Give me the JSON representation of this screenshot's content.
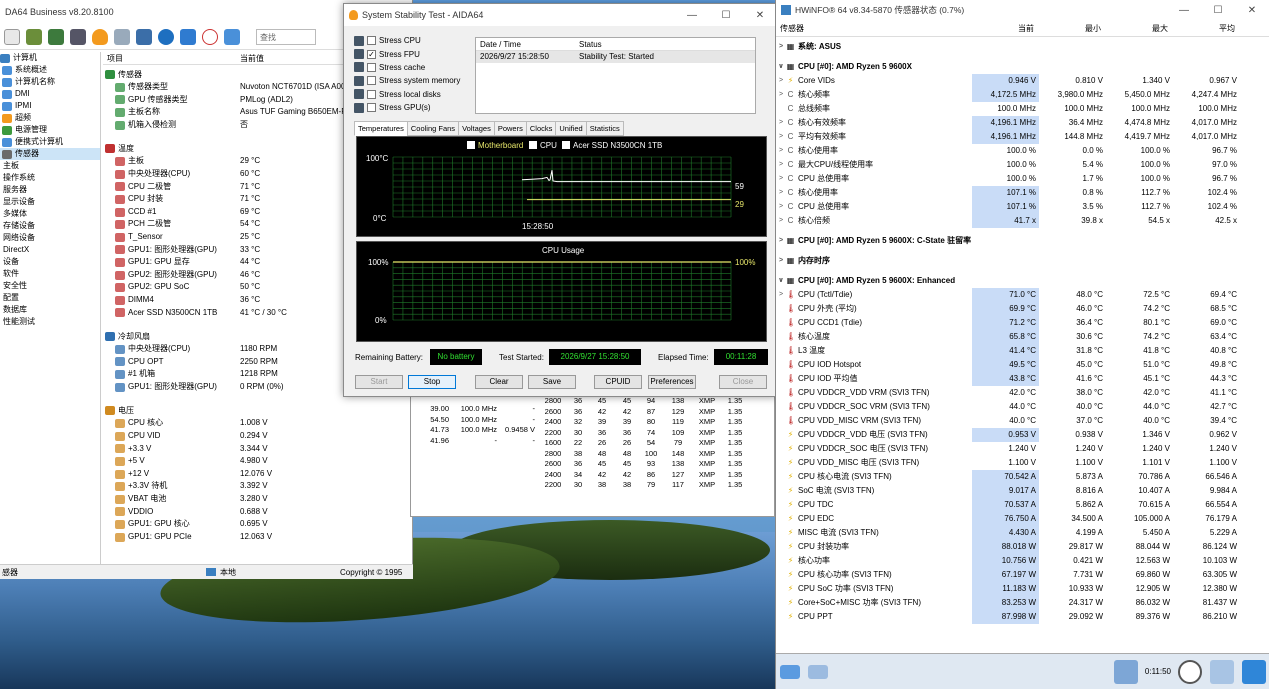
{
  "aida": {
    "title": "DA64 Business v8.20.8100",
    "search_placeholder": "查找",
    "tree": [
      "计算机",
      "系统概述",
      "计算机名称",
      "DMI",
      "IPMI",
      "超频",
      "电源管理",
      "便携式计算机",
      "传感器",
      "主板",
      "操作系统",
      "服务器",
      "显示设备",
      "多媒体",
      "存储设备",
      "网络设备",
      "DirectX",
      "设备",
      "软件",
      "安全性",
      "配置",
      "数据库",
      "性能测试"
    ],
    "col_item": "项目",
    "col_value": "当前值",
    "sections": [
      {
        "title": "传感器",
        "rows": [
          [
            "传感器类型",
            "Nuvoton NCT6701D  (ISA A00"
          ],
          [
            "GPU 传感器类型",
            "PMLog  (ADL2)"
          ],
          [
            "主板名称",
            "Asus TUF Gaming B650EM-PL"
          ],
          [
            "机箱入侵检测",
            "否"
          ]
        ]
      },
      {
        "title": "温度",
        "rows": [
          [
            "主板",
            "29 °C"
          ],
          [
            "中央处理器(CPU)",
            "60 °C"
          ],
          [
            "CPU 二极管",
            "71 °C"
          ],
          [
            "CPU 封装",
            "71 °C"
          ],
          [
            "CCD #1",
            "69 °C"
          ],
          [
            "PCH 二极管",
            "54 °C"
          ],
          [
            "T_Sensor",
            "25 °C"
          ],
          [
            "GPU1: 图形处理器(GPU)",
            "33 °C"
          ],
          [
            "GPU1: GPU 显存",
            "44 °C"
          ],
          [
            "GPU2: 图形处理器(GPU)",
            "46 °C"
          ],
          [
            "GPU2: GPU SoC",
            "50 °C"
          ],
          [
            "DIMM4",
            "36 °C"
          ],
          [
            "Acer SSD N3500CN 1TB",
            "41 °C / 30 °C"
          ]
        ]
      },
      {
        "title": "冷却风扇",
        "rows": [
          [
            "中央处理器(CPU)",
            "1180 RPM"
          ],
          [
            "CPU OPT",
            "2250 RPM"
          ],
          [
            "#1 机箱",
            "1218 RPM"
          ],
          [
            "GPU1: 图形处理器(GPU)",
            "0 RPM  (0%)"
          ]
        ]
      },
      {
        "title": "电压",
        "rows": [
          [
            "CPU 核心",
            "1.008 V"
          ],
          [
            "CPU VID",
            "0.294 V"
          ],
          [
            "+3.3 V",
            "3.344 V"
          ],
          [
            "+5 V",
            "4.980 V"
          ],
          [
            "+12 V",
            "12.076 V"
          ],
          [
            "+3.3V 待机",
            "3.392 V"
          ],
          [
            "VBAT 电池",
            "3.280 V"
          ],
          [
            "VDDIO",
            "0.688 V"
          ],
          [
            "GPU1: GPU 核心",
            "0.695 V"
          ],
          [
            "GPU1: GPU PCIe",
            "12.063 V"
          ]
        ]
      }
    ],
    "status_left": "感器",
    "status_mid": "本地",
    "status_right": "Copyright © 1995"
  },
  "bgwin": {
    "left": [
      [
        "39.00",
        "100.0 MHz",
        "-"
      ],
      [
        "54.50",
        "100.0 MHz",
        "-"
      ],
      [
        "41.73",
        "100.0 MHz",
        "0.9458 V"
      ],
      [
        "41.96",
        "-",
        "-"
      ]
    ],
    "right": [
      [
        "2800",
        "36",
        "45",
        "45",
        "94",
        "138",
        "XMP",
        "1.35"
      ],
      [
        "2600",
        "36",
        "42",
        "42",
        "87",
        "129",
        "XMP",
        "1.35"
      ],
      [
        "2400",
        "32",
        "39",
        "39",
        "80",
        "119",
        "XMP",
        "1.35"
      ],
      [
        "2200",
        "30",
        "36",
        "36",
        "74",
        "109",
        "XMP",
        "1.35"
      ],
      [
        "1600",
        "22",
        "26",
        "26",
        "54",
        "79",
        "XMP",
        "1.35"
      ],
      [
        "2800",
        "38",
        "48",
        "48",
        "100",
        "148",
        "XMP",
        "1.35"
      ],
      [
        "2600",
        "36",
        "45",
        "45",
        "93",
        "138",
        "XMP",
        "1.35"
      ],
      [
        "2400",
        "34",
        "42",
        "42",
        "86",
        "127",
        "XMP",
        "1.35"
      ],
      [
        "2200",
        "30",
        "38",
        "38",
        "79",
        "117",
        "XMP",
        "1.35"
      ]
    ]
  },
  "sst": {
    "title": "System Stability Test - AIDA64",
    "stress": [
      {
        "label": "Stress CPU",
        "checked": false
      },
      {
        "label": "Stress FPU",
        "checked": true
      },
      {
        "label": "Stress cache",
        "checked": false
      },
      {
        "label": "Stress system memory",
        "checked": false
      },
      {
        "label": "Stress local disks",
        "checked": false
      },
      {
        "label": "Stress GPU(s)",
        "checked": false
      }
    ],
    "col_date": "Date / Time",
    "col_status": "Status",
    "log_date": "2026/9/27 15:28:50",
    "log_status": "Stability Test: Started",
    "tabs": [
      "Temperatures",
      "Cooling Fans",
      "Voltages",
      "Powers",
      "Clocks",
      "Unified",
      "Statistics"
    ],
    "legend": [
      "Motherboard",
      "CPU",
      "Acer SSD N3500CN 1TB"
    ],
    "temp_top": "100°C",
    "temp_bottom": "0°C",
    "temp_time": "15:28:50",
    "val1": "59",
    "val2": "29",
    "cpu_title": "CPU Usage",
    "cpu_top": "100%",
    "cpu_bottom": "0%",
    "cpu_right": "100%",
    "battery_label": "Remaining Battery:",
    "battery": "No battery",
    "started_label": "Test Started:",
    "started": "2026/9/27 15:28:50",
    "elapsed_label": "Elapsed Time:",
    "elapsed": "00:11:28",
    "buttons": [
      "Start",
      "Stop",
      "Clear",
      "Save",
      "CPUID",
      "Preferences",
      "Close"
    ],
    "colors": {
      "motherboard": "#ffffff",
      "cpu": "#e6e66a",
      "grid": "#1f7a2a"
    }
  },
  "hw": {
    "title": "HWiNFO® 64 v8.34-5870 传感器状态 (0.7%)",
    "cols": [
      "传感器",
      "当前",
      "最小",
      "最大",
      "平均"
    ],
    "groups": [
      {
        "title": "系统: ASUS",
        "rows": []
      },
      {
        "title": "CPU [#0]: AMD Ryzen 5 9600X",
        "rows": [
          [
            "Core VIDs",
            "0.946 V",
            "0.810 V",
            "1.340 V",
            "0.967 V",
            "⚡",
            1
          ],
          [
            "核心频率",
            "4,172.5 MHz",
            "3,980.0 MHz",
            "5,450.0 MHz",
            "4,247.4 MHz",
            "C",
            1
          ],
          [
            "总线频率",
            "100.0 MHz",
            "100.0 MHz",
            "100.0 MHz",
            "100.0 MHz",
            "C",
            0
          ],
          [
            "核心有效频率",
            "4,196.1 MHz",
            "36.4 MHz",
            "4,474.8 MHz",
            "4,017.0 MHz",
            "C",
            1
          ],
          [
            "平均有效频率",
            "4,196.1 MHz",
            "144.8 MHz",
            "4,419.7 MHz",
            "4,017.0 MHz",
            "C",
            1
          ],
          [
            "核心使用率",
            "100.0 %",
            "0.0 %",
            "100.0 %",
            "96.7 %",
            "C",
            0
          ],
          [
            "最大CPU/线程使用率",
            "100.0 %",
            "5.4 %",
            "100.0 %",
            "97.0 %",
            "C",
            0
          ],
          [
            "CPU 总使用率",
            "100.0 %",
            "1.7 %",
            "100.0 %",
            "96.7 %",
            "C",
            0
          ],
          [
            "核心使用率",
            "107.1 %",
            "0.8 %",
            "112.7 %",
            "102.4 %",
            "C",
            1
          ],
          [
            "CPU 总使用率",
            "107.1 %",
            "3.5 %",
            "112.7 %",
            "102.4 %",
            "C",
            1
          ],
          [
            "核心倍频",
            "41.7 x",
            "39.8 x",
            "54.5 x",
            "42.5 x",
            "C",
            1
          ]
        ]
      },
      {
        "title": "CPU [#0]: AMD Ryzen 5 9600X: C-State 驻留率",
        "rows": []
      },
      {
        "title": "内存时序",
        "rows": []
      },
      {
        "title": "CPU [#0]: AMD Ryzen 5 9600X: Enhanced",
        "rows": [
          [
            "CPU (Tctl/Tdie)",
            "71.0 °C",
            "48.0 °C",
            "72.5 °C",
            "69.4 °C",
            "🌡",
            1
          ],
          [
            "CPU 外壳 (平均)",
            "69.9 °C",
            "46.0 °C",
            "74.2 °C",
            "68.5 °C",
            "🌡",
            1
          ],
          [
            "CPU CCD1 (Tdie)",
            "71.2 °C",
            "36.4 °C",
            "80.1 °C",
            "69.0 °C",
            "🌡",
            1
          ],
          [
            "核心温度",
            "65.8 °C",
            "30.6 °C",
            "74.2 °C",
            "63.4 °C",
            "🌡",
            1
          ],
          [
            "L3 温度",
            "41.4 °C",
            "31.8 °C",
            "41.8 °C",
            "40.8 °C",
            "🌡",
            1
          ],
          [
            "CPU IOD Hotspot",
            "49.5 °C",
            "45.0 °C",
            "51.0 °C",
            "49.8 °C",
            "🌡",
            1
          ],
          [
            "CPU IOD 平均值",
            "43.8 °C",
            "41.6 °C",
            "45.1 °C",
            "44.3 °C",
            "🌡",
            1
          ],
          [
            "CPU VDDCR_VDD VRM (SVI3 TFN)",
            "42.0 °C",
            "38.0 °C",
            "42.0 °C",
            "41.1 °C",
            "🌡",
            0
          ],
          [
            "CPU VDDCR_SOC VRM (SVI3 TFN)",
            "44.0 °C",
            "40.0 °C",
            "44.0 °C",
            "42.7 °C",
            "🌡",
            0
          ],
          [
            "CPU VDD_MISC VRM (SVI3 TFN)",
            "40.0 °C",
            "37.0 °C",
            "40.0 °C",
            "39.4 °C",
            "🌡",
            0
          ],
          [
            "CPU VDDCR_VDD 电压 (SVI3 TFN)",
            "0.953 V",
            "0.938 V",
            "1.346 V",
            "0.962 V",
            "⚡",
            1
          ],
          [
            "CPU VDDCR_SOC 电压 (SVI3 TFN)",
            "1.240 V",
            "1.240 V",
            "1.240 V",
            "1.240 V",
            "⚡",
            0
          ],
          [
            "CPU VDD_MISC 电压 (SVI3 TFN)",
            "1.100 V",
            "1.100 V",
            "1.101 V",
            "1.100 V",
            "⚡",
            0
          ],
          [
            "CPU 核心电流 (SVI3 TFN)",
            "70.542 A",
            "5.873 A",
            "70.786 A",
            "66.546 A",
            "⚡",
            1
          ],
          [
            "SoC 电流 (SVI3 TFN)",
            "9.017 A",
            "8.816 A",
            "10.407 A",
            "9.984 A",
            "⚡",
            1
          ],
          [
            "CPU TDC",
            "70.537 A",
            "5.862 A",
            "70.615 A",
            "66.554 A",
            "⚡",
            1
          ],
          [
            "CPU EDC",
            "76.750 A",
            "34.500 A",
            "105.000 A",
            "76.179 A",
            "⚡",
            1
          ],
          [
            "MISC 电流 (SVI3 TFN)",
            "4.430 A",
            "4.199 A",
            "5.450 A",
            "5.229 A",
            "⚡",
            1
          ],
          [
            "CPU 封装功率",
            "88.018 W",
            "29.817 W",
            "88.044 W",
            "86.124 W",
            "⚡",
            1
          ],
          [
            "核心功率",
            "10.756 W",
            "0.421 W",
            "12.563 W",
            "10.103 W",
            "⚡",
            1
          ],
          [
            "CPU 核心功率 (SVI3 TFN)",
            "67.197 W",
            "7.731 W",
            "69.860 W",
            "63.305 W",
            "⚡",
            1
          ],
          [
            "CPU SoC 功率 (SVI3 TFN)",
            "11.183 W",
            "10.933 W",
            "12.905 W",
            "12.380 W",
            "⚡",
            1
          ],
          [
            "Core+SoC+MISC 功率 (SVI3 TFN)",
            "83.253 W",
            "24.317 W",
            "86.032 W",
            "81.437 W",
            "⚡",
            1
          ],
          [
            "CPU PPT",
            "87.998 W",
            "29.092 W",
            "89.376 W",
            "86.210 W",
            "⚡",
            1
          ]
        ]
      }
    ],
    "elapsed": "0:11:50"
  }
}
